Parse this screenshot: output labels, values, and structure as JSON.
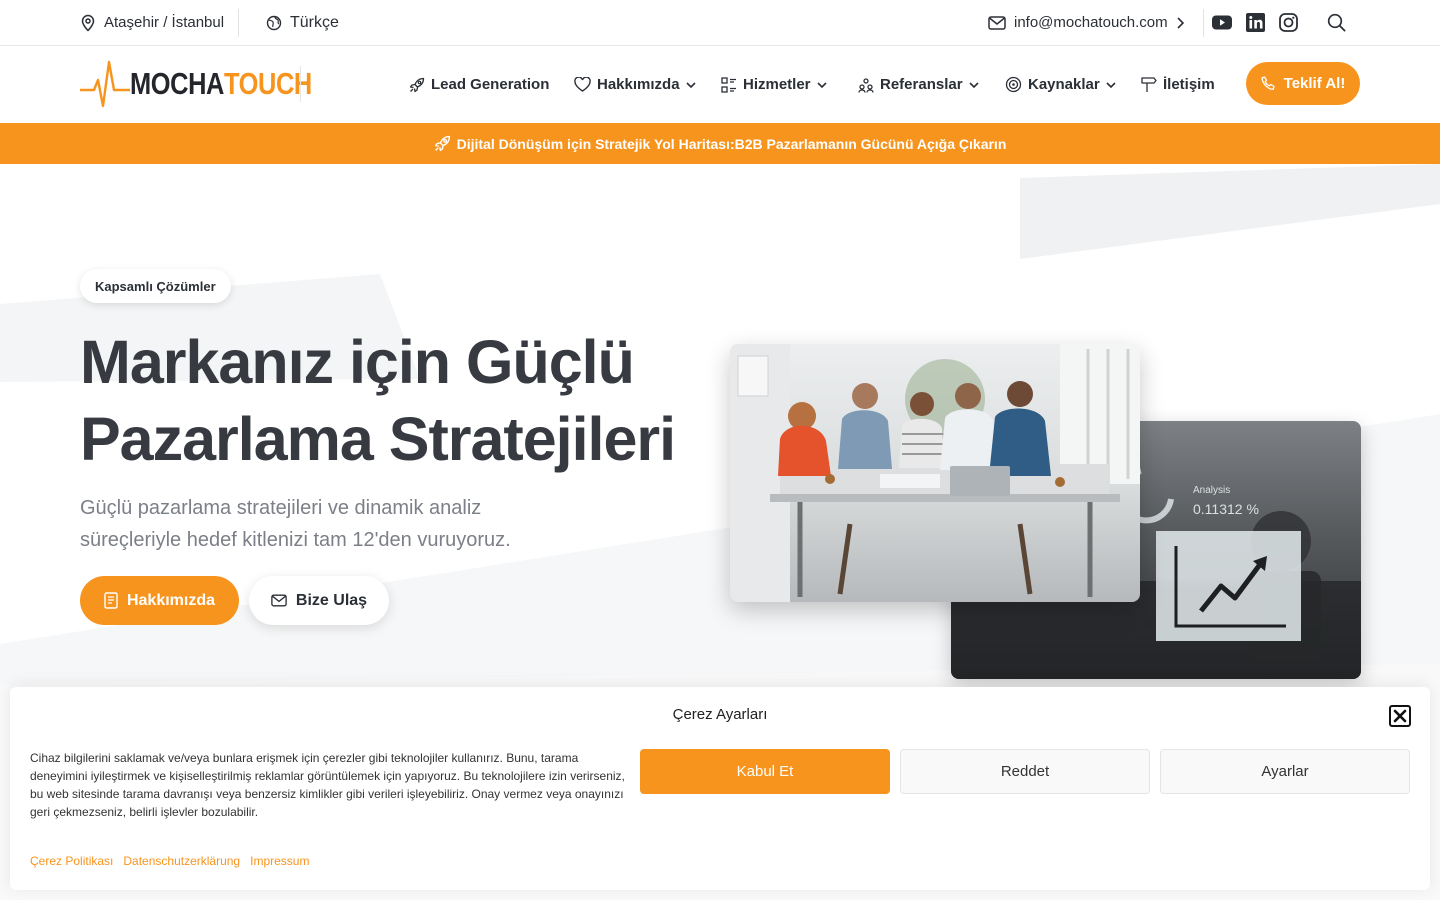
{
  "topbar": {
    "location": "Ataşehir / İstanbul",
    "language": "Türkçe",
    "email": "info@mochatouch.com"
  },
  "header": {
    "logo_part1": "MOCHA",
    "logo_part2": "TOUCH",
    "nav": [
      {
        "label": "Lead Generation"
      },
      {
        "label": "Hakkımızda"
      },
      {
        "label": "Hizmetler"
      },
      {
        "label": "Referanslar"
      },
      {
        "label": "Kaynaklar"
      },
      {
        "label": "İletişim"
      }
    ],
    "cta": "Teklif Al!"
  },
  "banner": {
    "text": "Dijital Dönüşüm için Stratejik Yol Haritası:B2B Pazarlamanın Gücünü Açığa Çıkarın"
  },
  "hero": {
    "pill": "Kapsamlı Çözümler",
    "title_line1": "Markanız için Güçlü",
    "title_line2": "Pazarlama Stratejileri",
    "subtitle": "Güçlü pazarlama stratejileri ve dinamik analiz süreçleriyle hedef kitlenizi tam 12'den vuruyoruz.",
    "btn_primary": "Hakkımızda",
    "btn_secondary": "Bize Ulaş",
    "photo_overlay_label": "Analysis",
    "photo_overlay_value": "0.11312 %"
  },
  "cookie": {
    "title": "Çerez Ayarları",
    "text": "Cihaz bilgilerini saklamak ve/veya bunlara erişmek için çerezler gibi teknolojiler kullanırız. Bunu, tarama deneyimini iyileştirmek ve kişiselleştirilmiş reklamlar görüntülemek için yapıyoruz. Bu teknolojilere izin verirseniz, bu web sitesinde tarama davranışı veya benzersiz kimlikler gibi verileri işleyebiliriz. Onay vermez veya onayınızı geri çekmezseniz, belirli işlevler bozulabilir.",
    "accept": "Kabul Et",
    "deny": "Reddet",
    "settings": "Ayarlar",
    "links": [
      "Çerez Politikası",
      "Datenschutzerklärung",
      "Impressum"
    ]
  },
  "colors": {
    "accent": "#f7941d",
    "heading": "#373a41",
    "muted": "#7b7f87"
  }
}
